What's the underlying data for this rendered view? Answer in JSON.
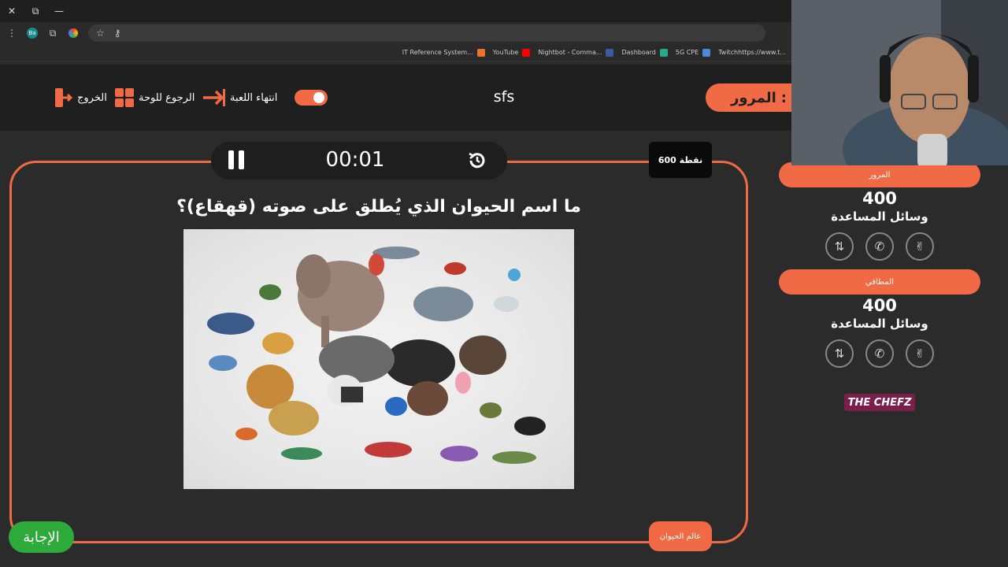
{
  "browser": {
    "window_controls": [
      "✕",
      "⧉",
      "—"
    ],
    "profile_initials": "Ba",
    "bookmarks": [
      {
        "label": "IT Reference System...",
        "color": "#e8732a"
      },
      {
        "label": "YouTube",
        "color": "#ff0000"
      },
      {
        "label": "Nightbot - Comma...",
        "color": "#3a5ba0"
      },
      {
        "label": "Dashboard",
        "color": "#2aa98a"
      },
      {
        "label": "5G CPE",
        "color": "#4a8ad8"
      },
      {
        "label": "Twitchhttps://www.t...",
        "color": "#9146ff"
      }
    ]
  },
  "header": {
    "exit_label": "الخروج",
    "back_label": "الرجوع للوحة",
    "end_game_label": "انتهاء اللعبة",
    "room_name": "sfs",
    "team_prefix": "ق :",
    "team_name": "المرور"
  },
  "question": {
    "timer": "00:01",
    "points": "600 نقطة",
    "text": "ما اسم الحيوان الذي يُطلق على صوته (قهقاع)؟",
    "category": "عالم الحيوان",
    "answer_label": "الإجابة"
  },
  "teams": [
    {
      "name": "المرور",
      "score": "400",
      "help_label": "وسائل المساعدة"
    },
    {
      "name": "المطافي",
      "score": "400",
      "help_label": "وسائل المساعدة"
    }
  ],
  "help_icons": [
    "two-answers-icon",
    "phone-icon",
    "hands-icon"
  ],
  "logo_text": "THE CHEFZ",
  "colors": {
    "accent": "#f06a45",
    "answer_green": "#2eaa3a",
    "background": "#2b2b2b",
    "header_bg": "#1f1f1f"
  }
}
